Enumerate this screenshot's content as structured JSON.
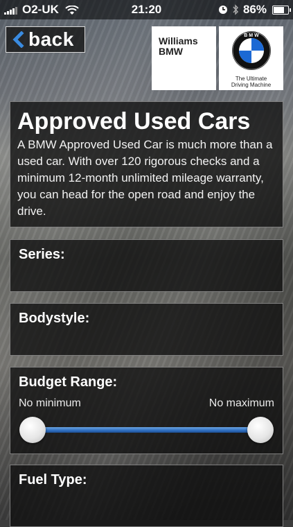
{
  "status_bar": {
    "carrier": "O2-UK",
    "time": "21:20",
    "battery": "86%",
    "battery_level": 0.86,
    "icons": [
      "signal-icon",
      "wifi-icon",
      "clock-icon",
      "bluetooth-icon",
      "battery-icon"
    ]
  },
  "nav": {
    "back_label": "back",
    "back_icon": "chevron-left-icon"
  },
  "dealer": {
    "line1": "Williams",
    "line2": "BMW"
  },
  "brand": {
    "tagline_line1": "The Ultimate",
    "tagline_line2": "Driving Machine"
  },
  "intro": {
    "title": "Approved Used Cars",
    "body": "A BMW Approved Used Car is much more than a used car. With over 120 rigorous checks and a minimum 12-month unlimited mileage warranty, you can head for the open road and enjoy the drive."
  },
  "filters": {
    "series_label": "Series:",
    "bodystyle_label": "Bodystyle:",
    "budget": {
      "label": "Budget Range:",
      "min_label": "No minimum",
      "max_label": "No maximum",
      "min_value": 0.0,
      "max_value": 1.0
    },
    "fuel_label": "Fuel Type:"
  },
  "colors": {
    "slider_fill": "#2f6fc0",
    "panel_bg": "#0f0f0f",
    "bmw_blue": "#1c69d4"
  }
}
